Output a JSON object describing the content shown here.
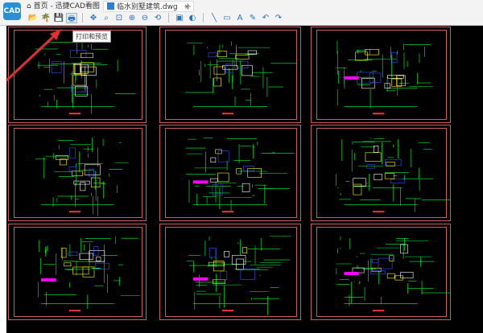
{
  "app": {
    "logo_text": "CAD",
    "home_tab": "首页 - 迅捷CAD看图",
    "file_tab": "临水别墅建筑.dwg",
    "close_glyph": "×",
    "add_glyph": "+"
  },
  "toolbar": [
    {
      "name": "open-icon",
      "glyph": "📂"
    },
    {
      "name": "palm-icon",
      "glyph": "🌴"
    },
    {
      "name": "save-icon",
      "glyph": "💾"
    },
    {
      "name": "print-icon",
      "glyph": "🖶",
      "active": true
    },
    {
      "sep": true
    },
    {
      "name": "pan-icon",
      "glyph": "✥"
    },
    {
      "name": "zoom-window-icon",
      "glyph": "⌕"
    },
    {
      "name": "zoom-extents-icon",
      "glyph": "⊡"
    },
    {
      "name": "zoom-in-icon",
      "glyph": "⊕"
    },
    {
      "name": "zoom-out-icon",
      "glyph": "⊖"
    },
    {
      "name": "zoom-previous-icon",
      "glyph": "⟲"
    },
    {
      "sep": true
    },
    {
      "name": "layer-icon",
      "glyph": "▣"
    },
    {
      "name": "3d-view-icon",
      "glyph": "◐"
    },
    {
      "sep": true
    },
    {
      "name": "line-icon",
      "glyph": "╲"
    },
    {
      "name": "rectangle-icon",
      "glyph": "▭"
    },
    {
      "name": "text-icon",
      "glyph": "A"
    },
    {
      "name": "eraser-icon",
      "glyph": "✎"
    },
    {
      "name": "undo-icon",
      "glyph": "↶"
    },
    {
      "name": "redo-icon",
      "glyph": "↷"
    }
  ],
  "tooltip": "打印和预览",
  "colors": {
    "sheet_border": "#c86060",
    "line": "#00ff33",
    "accent": "#ffff00",
    "wall": "#ffffff",
    "highlight": "#ff00ff",
    "arrow": "#e03030"
  }
}
